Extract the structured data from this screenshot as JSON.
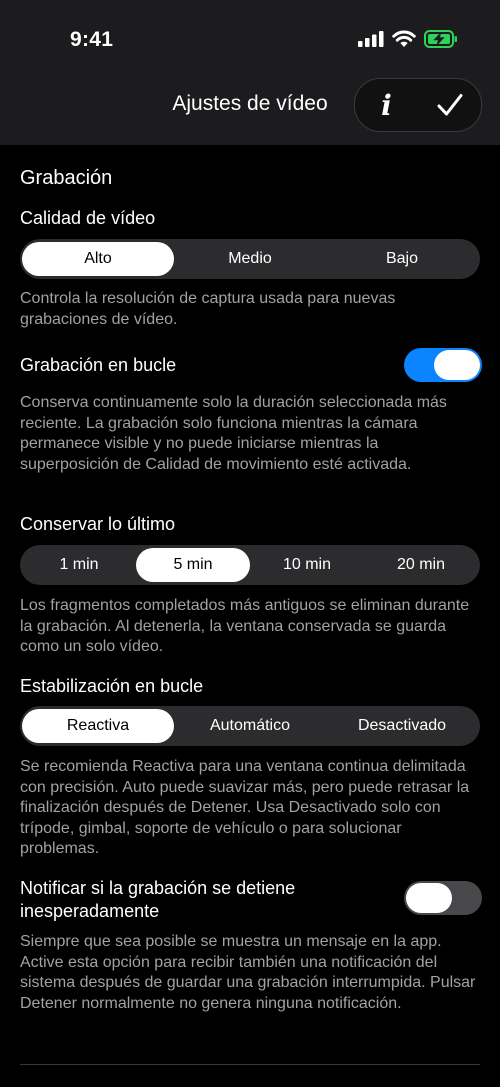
{
  "status_bar": {
    "time": "9:41"
  },
  "nav": {
    "title": "Ajustes de vídeo",
    "info_glyph": "i"
  },
  "recording": {
    "section_title": "Grabación",
    "quality": {
      "label": "Calidad de vídeo",
      "options": [
        "Alto",
        "Medio",
        "Bajo"
      ],
      "selected": "Alto",
      "description": "Controla la resolución de captura usada para nuevas grabaciones de vídeo."
    },
    "loop": {
      "label": "Grabación en bucle",
      "enabled": true,
      "description": "Conserva continuamente solo la duración seleccionada más reciente. La grabación solo funciona mientras la cámara permanece visible y no puede iniciarse mientras la superposición de Calidad de movimiento esté activada."
    },
    "keep_last": {
      "label": "Conservar lo último",
      "options": [
        "1 min",
        "5 min",
        "10 min",
        "20 min"
      ],
      "selected": "5 min",
      "description": "Los fragmentos completados más antiguos se eliminan durante la grabación. Al detenerla, la ventana conservada se guarda como un solo vídeo."
    },
    "stabilization": {
      "label": "Estabilización en bucle",
      "options": [
        "Reactiva",
        "Automático",
        "Desactivado"
      ],
      "selected": "Reactiva",
      "description": "Se recomienda Reactiva para una ventana continua delimitada con precisión. Auto puede suavizar más, pero puede retrasar la finalización después de Detener. Usa Desactivado solo con trípode, gimbal, soporte de vehículo o para solucionar problemas."
    },
    "notify": {
      "label": "Notificar si la grabación se detiene inesperadamente",
      "enabled": false,
      "description": "Siempre que sea posible se muestra un mensaje en la app. Active esta opción para recibir también una notificación del sistema después de guardar una grabación interrumpida. Pulsar Detener normalmente no genera ninguna notificación."
    }
  },
  "colors": {
    "accent": "#0a84ff",
    "toggle_off": "#48484a",
    "battery": "#30d158"
  },
  "icons": [
    "signal-icon",
    "wifi-icon",
    "battery-charging-icon",
    "info-icon",
    "checkmark-icon"
  ]
}
